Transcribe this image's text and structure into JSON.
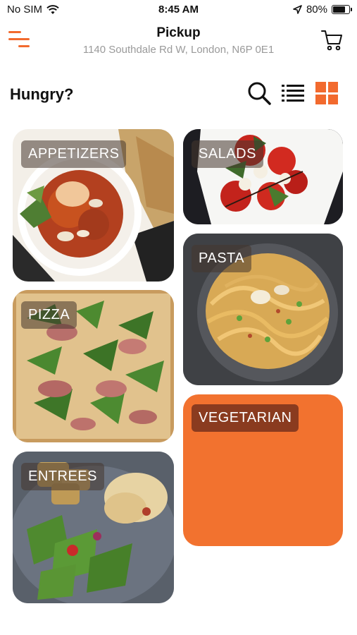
{
  "status_bar": {
    "carrier": "No SIM",
    "time": "8:45 AM",
    "battery": "80%",
    "battery_level": 0.8
  },
  "header": {
    "title": "Pickup",
    "address": "1140 Southdale Rd W, London, N6P 0E1",
    "icons": {
      "menu": "menu-icon",
      "cart": "cart-icon"
    }
  },
  "page": {
    "heading": "Hungry?",
    "icons": {
      "search": "search-icon",
      "list": "list-view-icon",
      "grid": "grid-view-icon"
    }
  },
  "categories": [
    {
      "label": "APPETIZERS"
    },
    {
      "label": "SALADS"
    },
    {
      "label": "PASTA"
    },
    {
      "label": "PIZZA"
    },
    {
      "label": "VEGETARIAN"
    },
    {
      "label": "ENTREES"
    }
  ],
  "colors": {
    "accent": "#f26a2e",
    "vegetarian_tile": "#f2722f",
    "subtitle_gray": "#9a9a9a"
  }
}
